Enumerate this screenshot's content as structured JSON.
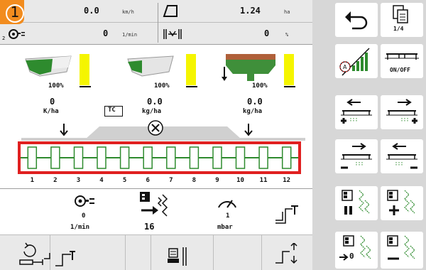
{
  "section_number": "1",
  "header": {
    "speed": {
      "value": "0.0",
      "unit": "km/h"
    },
    "area": {
      "value": "1.24",
      "unit": "ha"
    },
    "pto": {
      "value": "0",
      "unit": "1/min",
      "index": "2"
    },
    "slip": {
      "value": "0",
      "unit": "%"
    }
  },
  "hoppers": [
    {
      "percent": "100%",
      "rate": "0",
      "rate_unit": "K/ha",
      "level": 1.0
    },
    {
      "percent": "100%",
      "rate": "0.0",
      "rate_unit": "kg/ha",
      "level": 1.0,
      "badge": "TC"
    },
    {
      "percent": "100%",
      "rate": "0.0",
      "rate_unit": "kg/ha",
      "level": 1.0
    }
  ],
  "sections": [
    "1",
    "2",
    "3",
    "4",
    "5",
    "6",
    "7",
    "8",
    "9",
    "10",
    "11",
    "12"
  ],
  "bottom_info": {
    "pto_value": "0",
    "pto_unit": "1/min",
    "tramline_value": "16",
    "pressure_value": "1",
    "pressure_unit": "mbar"
  },
  "right_buttons": {
    "page_indicator": "1/4",
    "onoff_label": "ON/OFF",
    "reset_value": "0"
  },
  "colors": {
    "accent_orange": "#f28c1e",
    "highlight_red": "#e02020",
    "seed_green": "#2e8b2e",
    "fert_green": "#3f8f3a",
    "level_yellow": "#f5f500"
  }
}
